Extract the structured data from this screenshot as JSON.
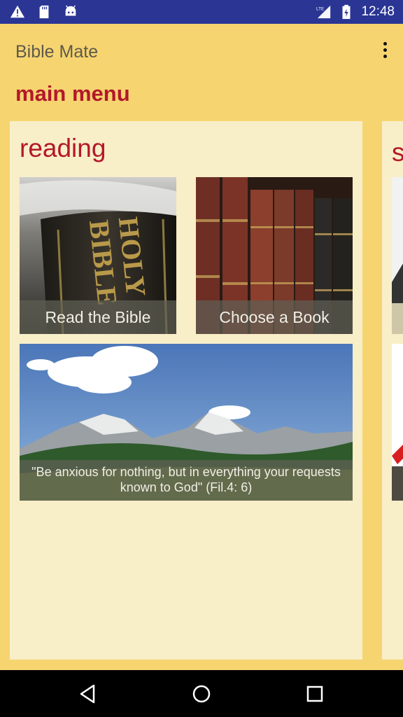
{
  "status_bar": {
    "time": "12:48",
    "network_label": "LTE",
    "icons": [
      "warning-icon",
      "sd-card-icon",
      "android-icon",
      "lte-signal-icon",
      "battery-icon"
    ]
  },
  "app_bar": {
    "title": "Bible Mate",
    "overflow_icon": "more-vert-icon"
  },
  "section_title": "main menu",
  "panels": [
    {
      "heading": "reading",
      "tiles": [
        {
          "label": "Read the Bible",
          "image": "holy-bible-book-photo"
        },
        {
          "label": "Choose a Book",
          "image": "old-books-shelf-photo"
        },
        {
          "label": "\"Be anxious for nothing, but in everything your requests known to God\" (Fil.4: 6)",
          "image": "mountain-landscape-photo"
        }
      ]
    },
    {
      "heading": "s"
    }
  ],
  "colors": {
    "status_bar": "#2a3594",
    "background": "#f6d470",
    "panel": "#f8eec8",
    "accent_red": "#b3182a"
  },
  "nav_bar": {
    "icons": [
      "back-icon",
      "home-icon",
      "recents-icon"
    ]
  }
}
